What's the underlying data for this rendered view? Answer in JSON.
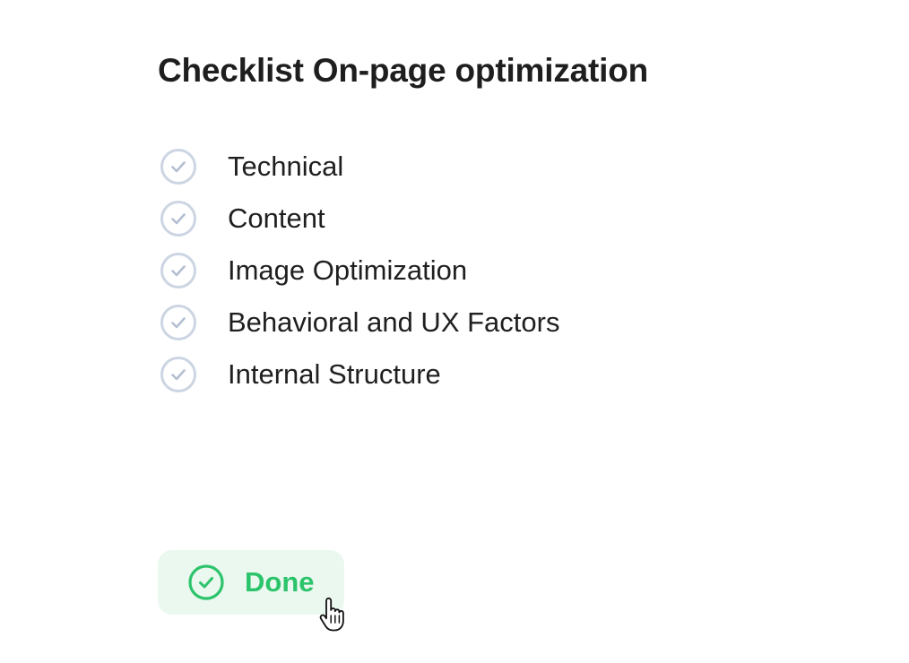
{
  "header": {
    "title": "Checklist On-page optimization"
  },
  "checklist": {
    "items": [
      {
        "label": "Technical",
        "icon": "check-circle-icon"
      },
      {
        "label": "Content",
        "icon": "check-circle-icon"
      },
      {
        "label": "Image Optimization",
        "icon": "check-circle-icon"
      },
      {
        "label": "Behavioral and UX Factors",
        "icon": "check-circle-icon"
      },
      {
        "label": "Internal Structure",
        "icon": "check-circle-icon"
      }
    ]
  },
  "done_button": {
    "label": "Done",
    "icon": "check-circle-icon"
  },
  "cursor": {
    "icon": "hand-pointer-icon"
  },
  "colors": {
    "text": "#1f1f1f",
    "check_outline": "#cdd5e3",
    "done_green": "#2cc46b",
    "done_background": "#eaf8ef"
  }
}
